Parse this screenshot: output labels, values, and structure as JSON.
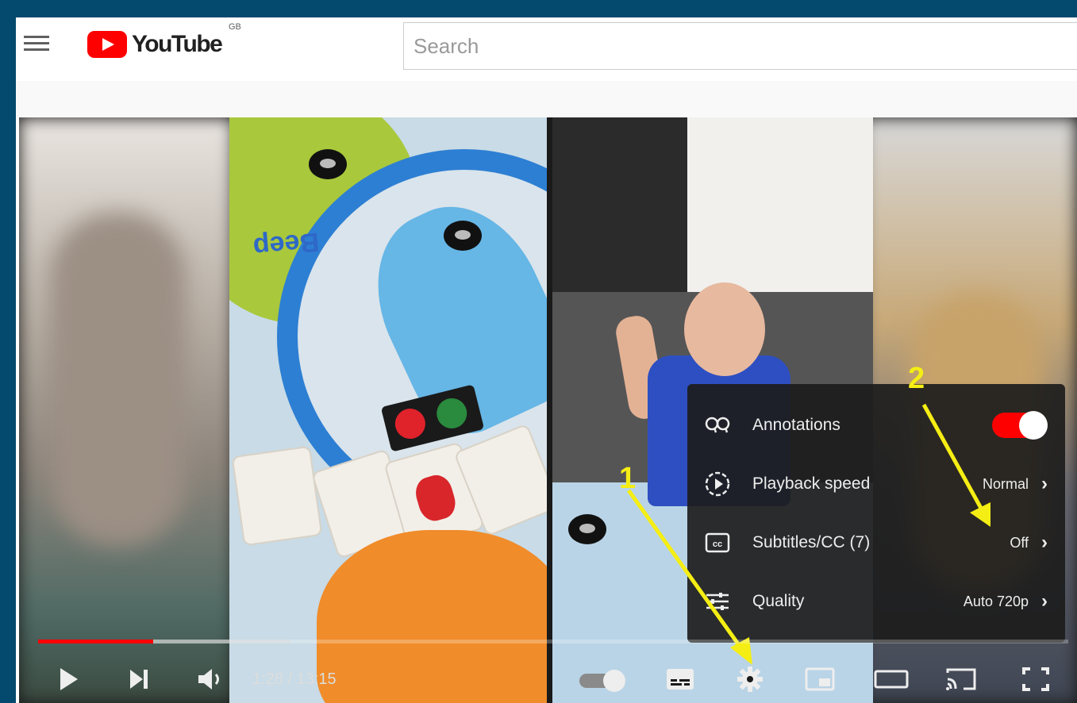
{
  "masthead": {
    "logo_text": "YouTube",
    "region_code": "GB",
    "search_placeholder": "Search"
  },
  "player": {
    "time_display": "1:28 / 13:15",
    "progress_fraction": 0.112,
    "buffered_fraction": 0.245,
    "video_text": "Beep",
    "autoplay_on": true,
    "controls": [
      "play-icon",
      "next-icon",
      "volume-icon",
      "autoplay-toggle",
      "subtitles-icon",
      "settings-icon",
      "miniplayer-icon",
      "theater-mode-icon",
      "cast-icon",
      "fullscreen-icon"
    ]
  },
  "settings_menu": {
    "items": [
      {
        "label": "Annotations",
        "value": "",
        "icon": "annotations-icon",
        "toggle_on": true
      },
      {
        "label": "Playback speed",
        "value": "Normal",
        "icon": "playback-speed-icon"
      },
      {
        "label": "Subtitles/CC (7)",
        "value": "Off",
        "icon": "subtitles-cc-icon"
      },
      {
        "label": "Quality",
        "value": "Auto 720p",
        "icon": "quality-icon"
      }
    ]
  },
  "annotations": {
    "step1": "1",
    "step2": "2",
    "arrow_color": "#f5ee14"
  },
  "colors": {
    "border": "#034a6e",
    "youtube_red": "#ff0000"
  }
}
